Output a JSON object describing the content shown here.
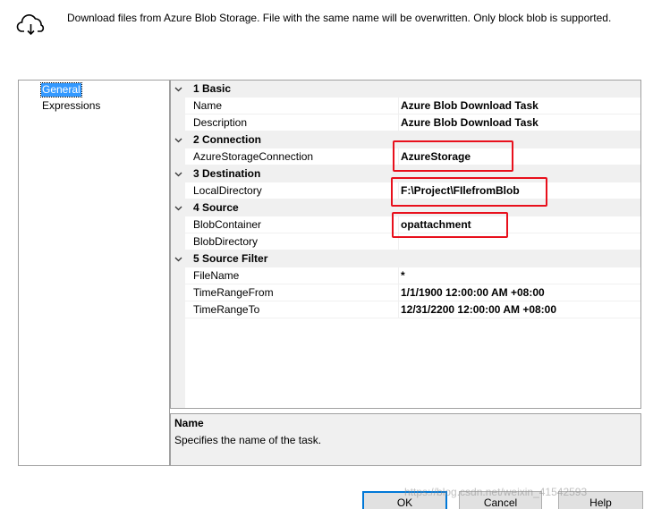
{
  "header": {
    "icon": "cloud-download-icon",
    "description": "Download files from Azure Blob Storage. File with the same name will be overwritten. Only block blob is supported."
  },
  "nav": {
    "items": [
      {
        "label": "General",
        "selected": true
      },
      {
        "label": "Expressions",
        "selected": false
      }
    ]
  },
  "grid": {
    "rows": [
      {
        "kind": "category",
        "label": "1 Basic"
      },
      {
        "kind": "property",
        "name": "Name",
        "value": "Azure Blob Download Task"
      },
      {
        "kind": "property",
        "name": "Description",
        "value": "Azure Blob Download Task"
      },
      {
        "kind": "category",
        "label": "2 Connection"
      },
      {
        "kind": "property",
        "name": "AzureStorageConnection",
        "value": "AzureStorage"
      },
      {
        "kind": "category",
        "label": "3 Destination"
      },
      {
        "kind": "property",
        "name": "LocalDirectory",
        "value": "F:\\Project\\FIlefromBlob"
      },
      {
        "kind": "category",
        "label": "4 Source"
      },
      {
        "kind": "property",
        "name": "BlobContainer",
        "value": "opattachment"
      },
      {
        "kind": "property",
        "name": "BlobDirectory",
        "value": ""
      },
      {
        "kind": "category",
        "label": "5 Source Filter"
      },
      {
        "kind": "property",
        "name": "FileName",
        "value": "*"
      },
      {
        "kind": "property",
        "name": "TimeRangeFrom",
        "value": "1/1/1900 12:00:00 AM +08:00"
      },
      {
        "kind": "property",
        "name": "TimeRangeTo",
        "value": "12/31/2200 12:00:00 AM +08:00"
      }
    ]
  },
  "description_panel": {
    "title": "Name",
    "text": "Specifies the name of the task."
  },
  "buttons": {
    "ok": "OK",
    "cancel": "Cancel",
    "help": "Help"
  },
  "watermark": "https://blog.csdn.net/weixin_41542593",
  "colors": {
    "selection": "#3399ff",
    "highlight": "#e8101c",
    "grid_line": "#f0f0f0",
    "default_button_border": "#0078d7"
  }
}
